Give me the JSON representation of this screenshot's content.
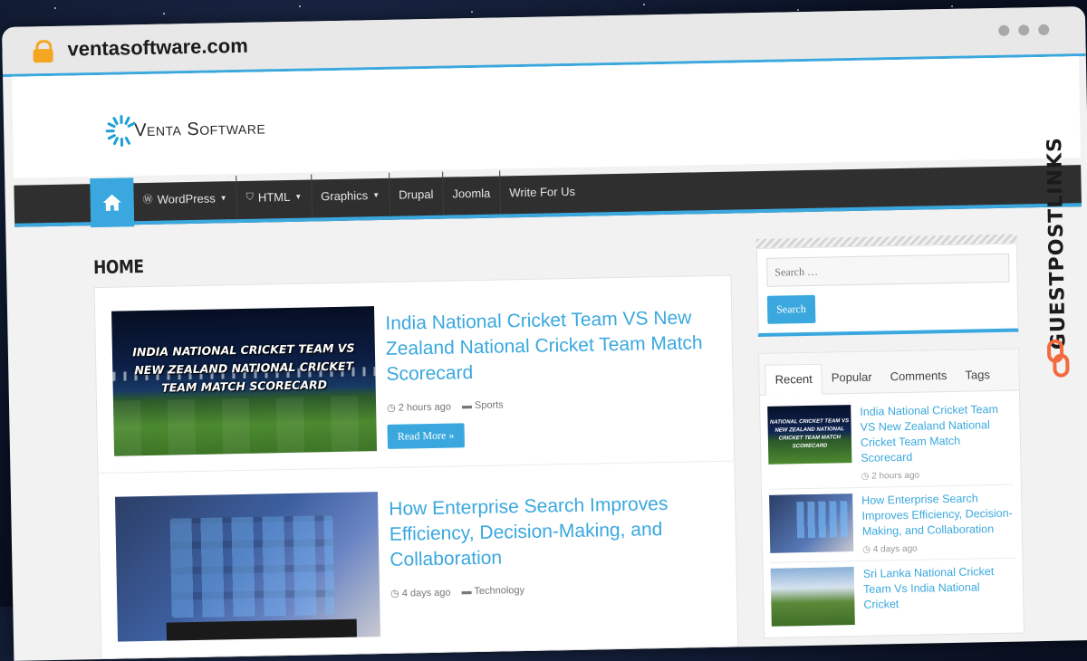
{
  "browser": {
    "url": "ventasoftware.com"
  },
  "site": {
    "logo_text": "Venta Software",
    "nav": {
      "items": [
        {
          "label": "WordPress",
          "dropdown": true,
          "icon": "wordpress-icon"
        },
        {
          "label": "HTML",
          "dropdown": true,
          "icon": "html5-icon"
        },
        {
          "label": "Graphics",
          "dropdown": true
        },
        {
          "label": "Drupal",
          "dropdown": false
        },
        {
          "label": "Joomla",
          "dropdown": false
        },
        {
          "label": "Write For Us",
          "dropdown": false
        }
      ]
    },
    "page_title": "Home",
    "posts": [
      {
        "title": "India National Cricket Team VS New Zealand National Cricket Team Match Scorecard",
        "thumb_caption": "INDIA NATIONAL CRICKET TEAM VS NEW ZEALAND NATIONAL CRICKET TEAM MATCH SCORECARD",
        "time": "2 hours ago",
        "category": "Sports",
        "read_more": "Read More »"
      },
      {
        "title": "How Enterprise Search Improves Efficiency, Decision-Making, and Collaboration",
        "time": "4 days ago",
        "category": "Technology"
      }
    ],
    "sidebar": {
      "search_placeholder": "Search …",
      "search_button": "Search",
      "tabs": [
        "Recent",
        "Popular",
        "Comments",
        "Tags"
      ],
      "recent": [
        {
          "title": "India National Cricket Team VS New Zealand National Cricket Team Match Scorecard",
          "time": "2 hours ago",
          "thumb_caption": "NATIONAL CRICKET TEAM VS NEW ZEALAND NATIONAL CRICKET TEAM MATCH SCORECARD"
        },
        {
          "title": "How Enterprise Search Improves Efficiency, Decision-Making, and Collaboration",
          "time": "4 days ago"
        },
        {
          "title": "Sri Lanka National Cricket Team Vs India National Cricket",
          "time": ""
        }
      ]
    }
  },
  "banner": {
    "text": "GUESTPOSTLINKS"
  },
  "colors": {
    "accent": "#3aa8de",
    "nav_bg": "#2f2f2f",
    "lock": "#f4a623",
    "banner_icon": "#f26a3d"
  }
}
